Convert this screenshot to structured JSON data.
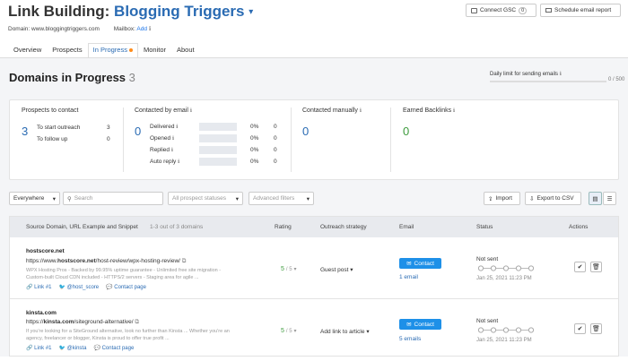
{
  "header": {
    "title_prefix": "Link Building: ",
    "project": "Blogging Triggers",
    "chevron": "▾",
    "domain_label": "Domain:",
    "domain": "www.bloggingtriggers.com",
    "mailbox_label": "Mailbox:",
    "mailbox_action": "Add",
    "connect_gsc_label": "Connect GSC",
    "connect_gsc_count": "0",
    "schedule_email_label": "Schedule email report"
  },
  "tabs": [
    {
      "label": "Overview"
    },
    {
      "label": "Prospects"
    },
    {
      "label": "In Progress",
      "active": true
    },
    {
      "label": "Monitor"
    },
    {
      "label": "About"
    }
  ],
  "section": {
    "title": "Domains in Progress",
    "count": "3",
    "daily_limit_label": "Daily limit for sending emails",
    "daily_limit_value": "0 / 500"
  },
  "summary": {
    "prospects": {
      "title": "Prospects to contact",
      "total": "3",
      "rows": [
        {
          "label": "To start outreach",
          "value": "3"
        },
        {
          "label": "To follow up",
          "value": "0"
        }
      ]
    },
    "email": {
      "title": "Contacted by email",
      "total": "0",
      "rows": [
        {
          "label": "Delivered",
          "value": "0%",
          "n": "0"
        },
        {
          "label": "Opened",
          "value": "0%",
          "n": "0"
        },
        {
          "label": "Replied",
          "value": "0%",
          "n": "0"
        },
        {
          "label": "Auto reply",
          "value": "0%",
          "n": "0"
        }
      ]
    },
    "manual": {
      "title": "Contacted manually",
      "total": "0"
    },
    "backlinks": {
      "title": "Earned Backlinks",
      "total": "0"
    }
  },
  "filters": {
    "region": "Everywhere",
    "search_placeholder": "Search",
    "statuses": "All prospect statuses",
    "advanced": "Advanced filters",
    "import": "Import",
    "export": "Export to CSV"
  },
  "table": {
    "columns": {
      "source": "Source Domain, URL Example and Snippet",
      "range": "1-3 out of 3 domains",
      "rating": "Rating",
      "strategy": "Outreach strategy",
      "email": "Email",
      "status": "Status",
      "actions": "Actions"
    },
    "rows": [
      {
        "domain": "hostscore.net",
        "url_prefix": "https://www.",
        "url_domain": "hostscore.net",
        "url_path": "/host-review/wpx-hosting-review/",
        "snippet1": "WPX Hosting Pros - Backed by 99.95% uptime guarantee - Unlimited free site migration -",
        "snippet2": "Custom-built Cloud CDN included - HTTPS/2 servers - Staging area for agile ...",
        "link_label": "Link #1",
        "twitter": "@host_score",
        "contact_page": "Contact page",
        "rating": "5",
        "rating_max": "/ 5",
        "strategy": "Guest post",
        "contact_label": "Contact",
        "emails": "1 email",
        "status": "Not sent",
        "date": "Jan 25, 2021 11:23 PM"
      },
      {
        "domain": "kinsta.com",
        "url_prefix": "https://",
        "url_domain": "kinsta.com",
        "url_path": "/siteground-alternative/",
        "snippet1": "If you're looking for a SiteGround alternative, look no further than Kinsta ... Whether you're an",
        "snippet2": "agency, freelancer or blogger, Kinsta is proud to offer true profit ...",
        "link_label": "Link #1",
        "twitter": "@kinsta",
        "contact_page": "Contact page",
        "rating": "5",
        "rating_max": "/ 5",
        "strategy": "Add link to article",
        "contact_label": "Contact",
        "emails": "5 emails",
        "status": "Not sent",
        "date": "Jan 25, 2021 11:23 PM"
      }
    ]
  },
  "colors": {
    "brand_blue": "#2a6bb3",
    "contact_button": "#1e90e8",
    "success_green": "#3d9b3d",
    "accent_orange": "#ff8c1a"
  }
}
